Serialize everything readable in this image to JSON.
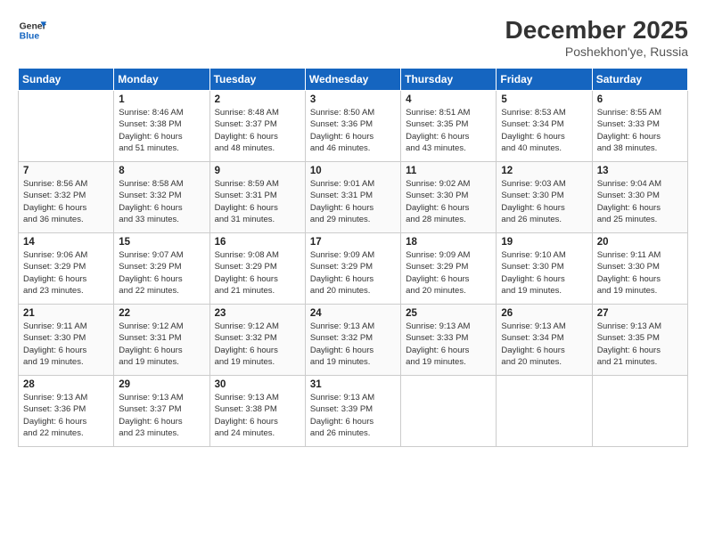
{
  "logo": {
    "line1": "General",
    "line2": "Blue"
  },
  "title": "December 2025",
  "location": "Poshekhon'ye, Russia",
  "days_header": [
    "Sunday",
    "Monday",
    "Tuesday",
    "Wednesday",
    "Thursday",
    "Friday",
    "Saturday"
  ],
  "weeks": [
    [
      {
        "day": "",
        "info": ""
      },
      {
        "day": "1",
        "info": "Sunrise: 8:46 AM\nSunset: 3:38 PM\nDaylight: 6 hours\nand 51 minutes."
      },
      {
        "day": "2",
        "info": "Sunrise: 8:48 AM\nSunset: 3:37 PM\nDaylight: 6 hours\nand 48 minutes."
      },
      {
        "day": "3",
        "info": "Sunrise: 8:50 AM\nSunset: 3:36 PM\nDaylight: 6 hours\nand 46 minutes."
      },
      {
        "day": "4",
        "info": "Sunrise: 8:51 AM\nSunset: 3:35 PM\nDaylight: 6 hours\nand 43 minutes."
      },
      {
        "day": "5",
        "info": "Sunrise: 8:53 AM\nSunset: 3:34 PM\nDaylight: 6 hours\nand 40 minutes."
      },
      {
        "day": "6",
        "info": "Sunrise: 8:55 AM\nSunset: 3:33 PM\nDaylight: 6 hours\nand 38 minutes."
      }
    ],
    [
      {
        "day": "7",
        "info": "Sunrise: 8:56 AM\nSunset: 3:32 PM\nDaylight: 6 hours\nand 36 minutes."
      },
      {
        "day": "8",
        "info": "Sunrise: 8:58 AM\nSunset: 3:32 PM\nDaylight: 6 hours\nand 33 minutes."
      },
      {
        "day": "9",
        "info": "Sunrise: 8:59 AM\nSunset: 3:31 PM\nDaylight: 6 hours\nand 31 minutes."
      },
      {
        "day": "10",
        "info": "Sunrise: 9:01 AM\nSunset: 3:31 PM\nDaylight: 6 hours\nand 29 minutes."
      },
      {
        "day": "11",
        "info": "Sunrise: 9:02 AM\nSunset: 3:30 PM\nDaylight: 6 hours\nand 28 minutes."
      },
      {
        "day": "12",
        "info": "Sunrise: 9:03 AM\nSunset: 3:30 PM\nDaylight: 6 hours\nand 26 minutes."
      },
      {
        "day": "13",
        "info": "Sunrise: 9:04 AM\nSunset: 3:30 PM\nDaylight: 6 hours\nand 25 minutes."
      }
    ],
    [
      {
        "day": "14",
        "info": "Sunrise: 9:06 AM\nSunset: 3:29 PM\nDaylight: 6 hours\nand 23 minutes."
      },
      {
        "day": "15",
        "info": "Sunrise: 9:07 AM\nSunset: 3:29 PM\nDaylight: 6 hours\nand 22 minutes."
      },
      {
        "day": "16",
        "info": "Sunrise: 9:08 AM\nSunset: 3:29 PM\nDaylight: 6 hours\nand 21 minutes."
      },
      {
        "day": "17",
        "info": "Sunrise: 9:09 AM\nSunset: 3:29 PM\nDaylight: 6 hours\nand 20 minutes."
      },
      {
        "day": "18",
        "info": "Sunrise: 9:09 AM\nSunset: 3:29 PM\nDaylight: 6 hours\nand 20 minutes."
      },
      {
        "day": "19",
        "info": "Sunrise: 9:10 AM\nSunset: 3:30 PM\nDaylight: 6 hours\nand 19 minutes."
      },
      {
        "day": "20",
        "info": "Sunrise: 9:11 AM\nSunset: 3:30 PM\nDaylight: 6 hours\nand 19 minutes."
      }
    ],
    [
      {
        "day": "21",
        "info": "Sunrise: 9:11 AM\nSunset: 3:30 PM\nDaylight: 6 hours\nand 19 minutes."
      },
      {
        "day": "22",
        "info": "Sunrise: 9:12 AM\nSunset: 3:31 PM\nDaylight: 6 hours\nand 19 minutes."
      },
      {
        "day": "23",
        "info": "Sunrise: 9:12 AM\nSunset: 3:32 PM\nDaylight: 6 hours\nand 19 minutes."
      },
      {
        "day": "24",
        "info": "Sunrise: 9:13 AM\nSunset: 3:32 PM\nDaylight: 6 hours\nand 19 minutes."
      },
      {
        "day": "25",
        "info": "Sunrise: 9:13 AM\nSunset: 3:33 PM\nDaylight: 6 hours\nand 19 minutes."
      },
      {
        "day": "26",
        "info": "Sunrise: 9:13 AM\nSunset: 3:34 PM\nDaylight: 6 hours\nand 20 minutes."
      },
      {
        "day": "27",
        "info": "Sunrise: 9:13 AM\nSunset: 3:35 PM\nDaylight: 6 hours\nand 21 minutes."
      }
    ],
    [
      {
        "day": "28",
        "info": "Sunrise: 9:13 AM\nSunset: 3:36 PM\nDaylight: 6 hours\nand 22 minutes."
      },
      {
        "day": "29",
        "info": "Sunrise: 9:13 AM\nSunset: 3:37 PM\nDaylight: 6 hours\nand 23 minutes."
      },
      {
        "day": "30",
        "info": "Sunrise: 9:13 AM\nSunset: 3:38 PM\nDaylight: 6 hours\nand 24 minutes."
      },
      {
        "day": "31",
        "info": "Sunrise: 9:13 AM\nSunset: 3:39 PM\nDaylight: 6 hours\nand 26 minutes."
      },
      {
        "day": "",
        "info": ""
      },
      {
        "day": "",
        "info": ""
      },
      {
        "day": "",
        "info": ""
      }
    ]
  ]
}
